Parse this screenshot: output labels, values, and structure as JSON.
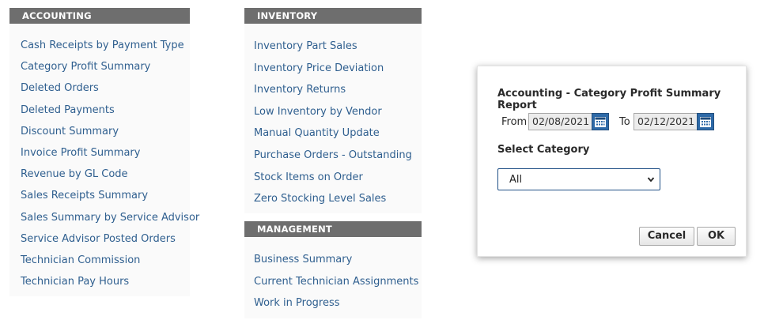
{
  "accounting": {
    "header": "ACCOUNTING",
    "items": [
      {
        "label": "Cash Receipts by Payment Type"
      },
      {
        "label": "Category Profit Summary"
      },
      {
        "label": "Deleted Orders"
      },
      {
        "label": "Deleted Payments"
      },
      {
        "label": "Discount Summary"
      },
      {
        "label": "Invoice Profit Summary"
      },
      {
        "label": "Revenue by GL Code"
      },
      {
        "label": "Sales Receipts Summary"
      },
      {
        "label": "Sales Summary by Service Advisor"
      },
      {
        "label": "Service Advisor Posted Orders"
      },
      {
        "label": "Technician Commission"
      },
      {
        "label": "Technician Pay Hours"
      }
    ]
  },
  "inventory": {
    "header": "INVENTORY",
    "items": [
      {
        "label": "Inventory Part Sales"
      },
      {
        "label": "Inventory Price Deviation"
      },
      {
        "label": "Inventory Returns"
      },
      {
        "label": "Low Inventory by Vendor"
      },
      {
        "label": "Manual Quantity Update"
      },
      {
        "label": "Purchase Orders - Outstanding"
      },
      {
        "label": "Stock Items on Order"
      },
      {
        "label": "Zero Stocking Level Sales"
      }
    ]
  },
  "management": {
    "header": "MANAGEMENT",
    "items": [
      {
        "label": "Business Summary"
      },
      {
        "label": "Current Technician Assignments"
      },
      {
        "label": "Work in Progress"
      }
    ]
  },
  "dialog": {
    "title": "Accounting - Category Profit Summary Report",
    "from_label": "From",
    "from_value": "02/08/2021",
    "to_label": "To",
    "to_value": "02/12/2021",
    "category_label": "Select Category",
    "category_value": "All",
    "cancel_label": "Cancel",
    "ok_label": "OK",
    "calendar_icon": "calendar-icon"
  },
  "colors": {
    "header_bg": "#6e6e6e",
    "link": "#2f5f8f",
    "calendar_button": "#2e6aa8"
  }
}
